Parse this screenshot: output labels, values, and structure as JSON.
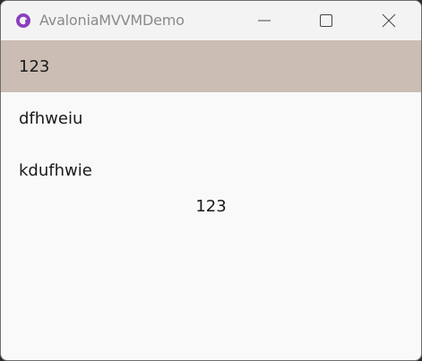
{
  "window": {
    "title": "AvaloniaMVVMDemo",
    "icon": "avalonia-logo-icon",
    "controls": [
      "minimize-icon",
      "maximize-icon",
      "close-icon"
    ]
  },
  "list": {
    "items": [
      {
        "label": "123",
        "selected": true
      },
      {
        "label": "dfhweiu",
        "selected": false
      },
      {
        "label": "kdufhwie",
        "selected": false
      }
    ]
  },
  "selected_text": "123",
  "colors": {
    "selection": "#cbbdb3",
    "titlebar": "#f3f3f3",
    "content_background": "#f9f9f9",
    "icon_accent": "#8b3fbf"
  }
}
